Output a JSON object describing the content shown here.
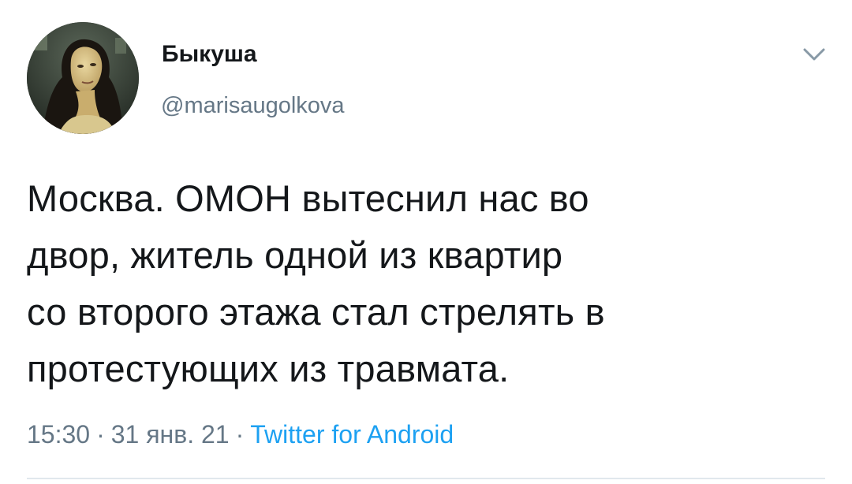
{
  "user": {
    "display_name": "Быкуша",
    "handle": "@marisaugolkova"
  },
  "tweet": {
    "text_lines": [
      "Москва. ОМОН вытеснил нас во",
      "двор, житель одной из квартир",
      "со второго этажа стал стрелять в",
      "протестующих из травмата."
    ],
    "time": "15:30",
    "date": "31 янв. 21",
    "separator": "·",
    "source": "Twitter for Android"
  },
  "icons": {
    "menu": "chevron-down-icon"
  },
  "colors": {
    "text": "#14171a",
    "secondary": "#657786",
    "link": "#1da1f2",
    "divider": "#e1e8ed"
  }
}
